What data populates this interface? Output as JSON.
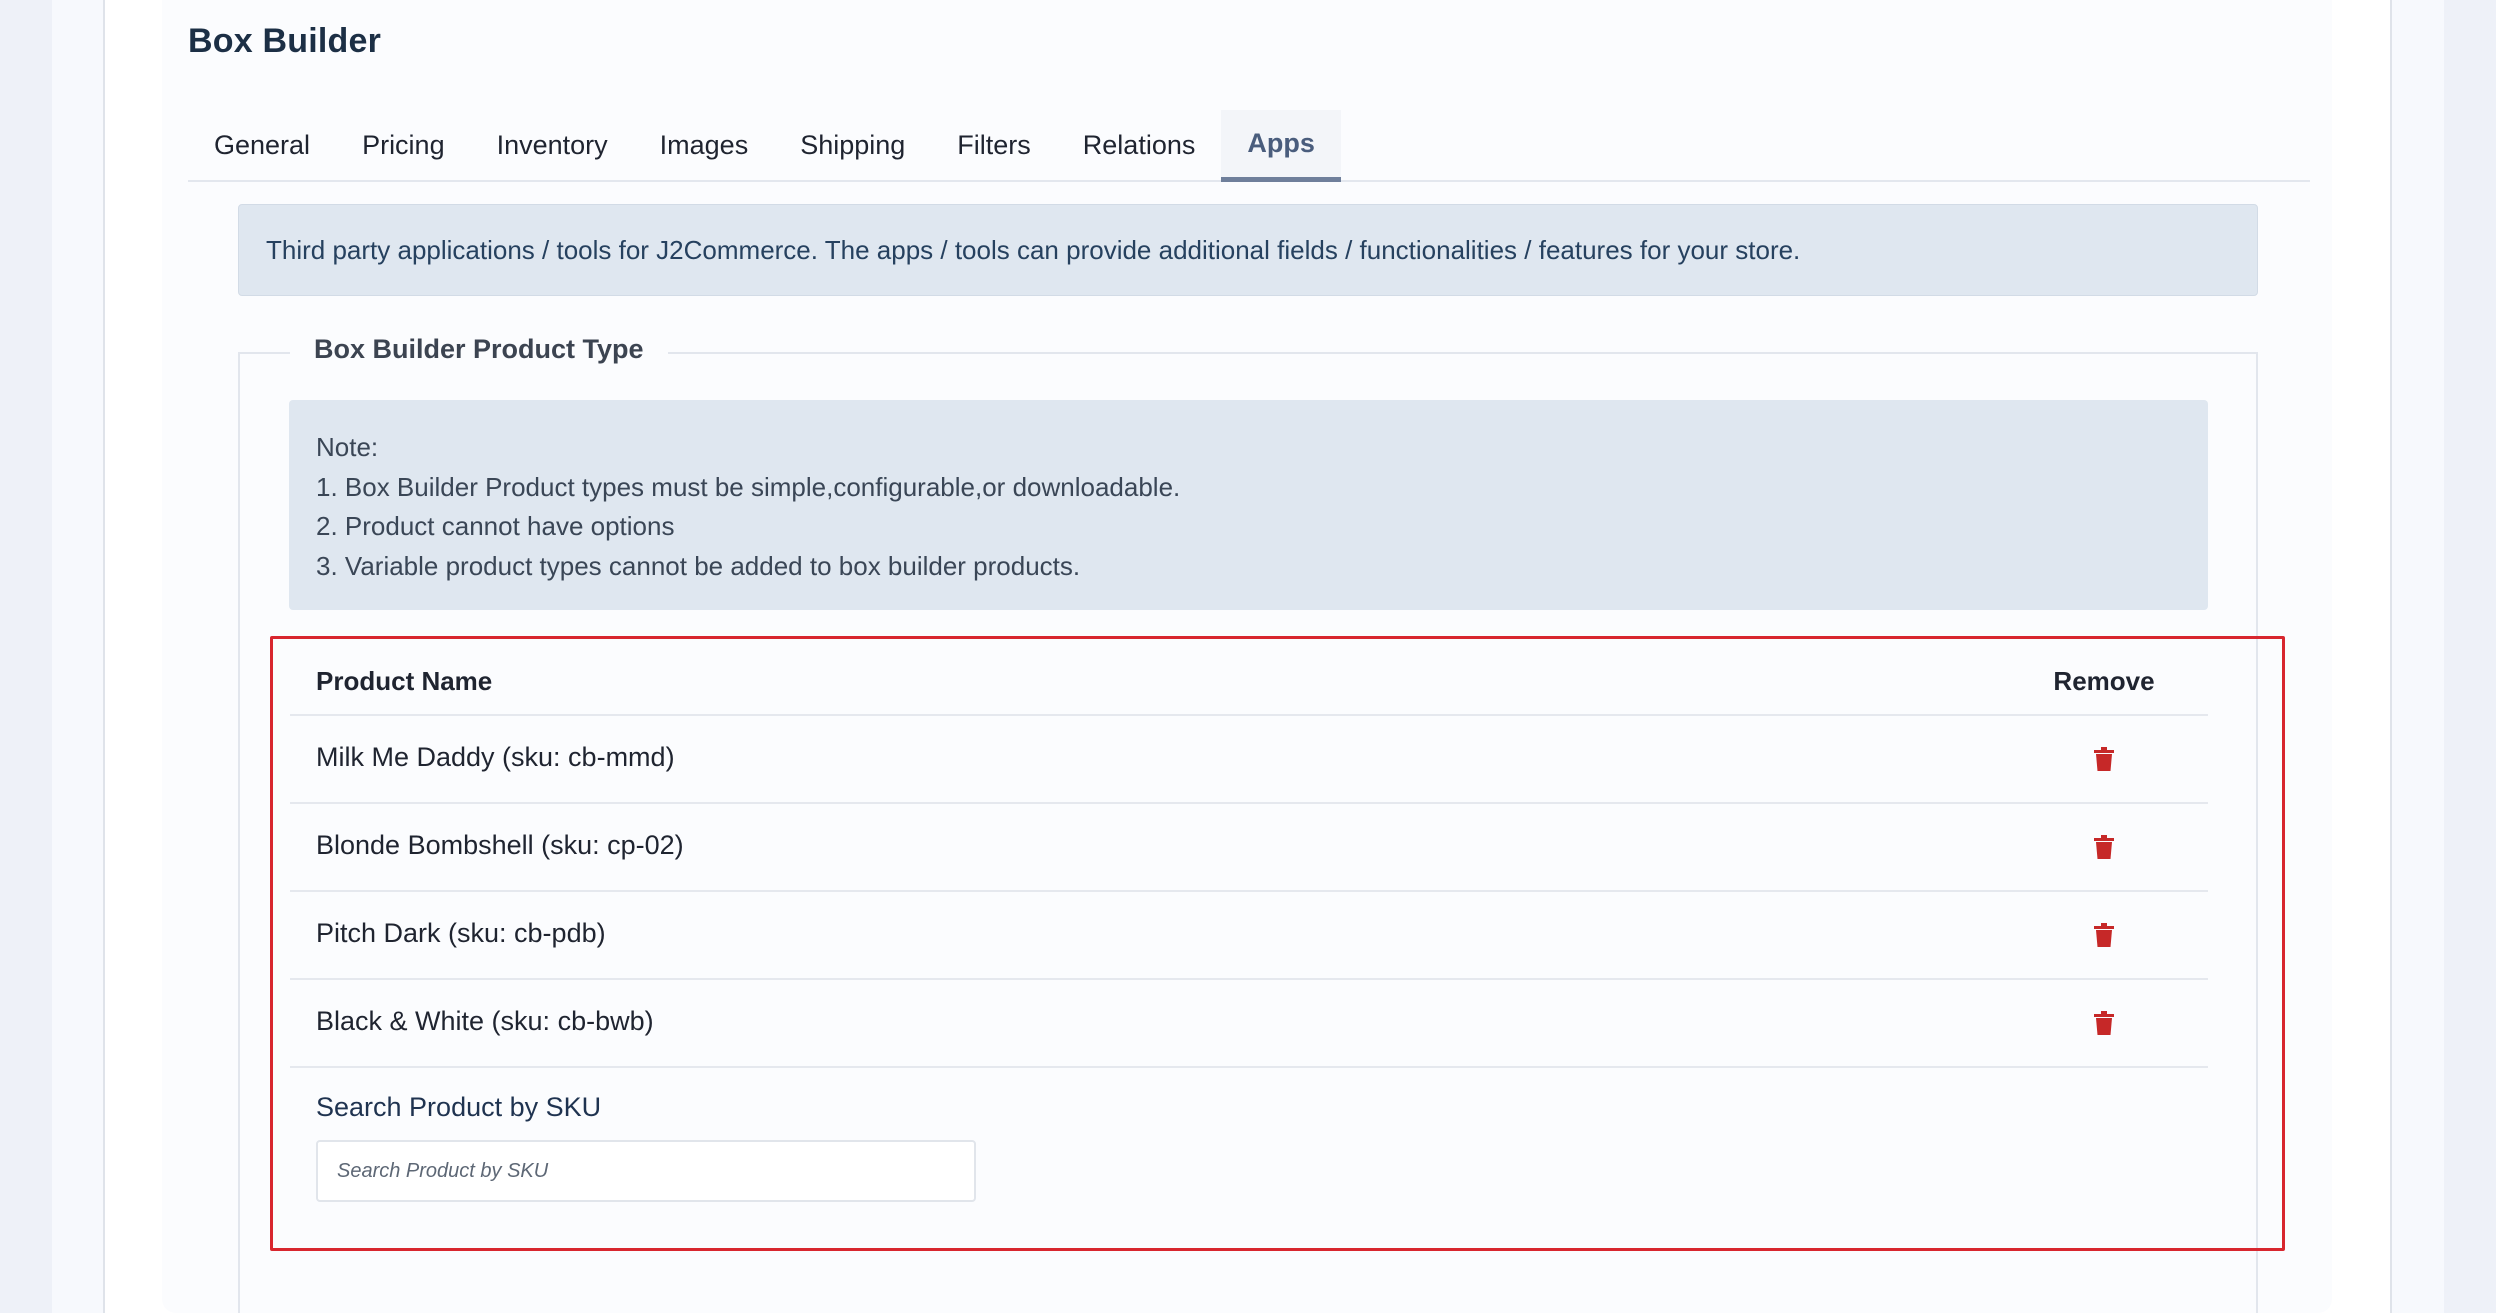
{
  "card": {
    "title": "Box Builder"
  },
  "tabs": [
    {
      "label": "General"
    },
    {
      "label": "Pricing"
    },
    {
      "label": "Inventory"
    },
    {
      "label": "Images"
    },
    {
      "label": "Shipping"
    },
    {
      "label": "Filters"
    },
    {
      "label": "Relations"
    },
    {
      "label": "Apps",
      "active": true
    }
  ],
  "apps_info": "Third party applications / tools for J2Commerce. The apps / tools can provide additional fields / functionalities / features for your store.",
  "fieldset": {
    "legend": "Box Builder Product Type",
    "note": {
      "title": "Note:",
      "lines": [
        "1. Box Builder Product types must be simple,configurable,or downloadable.",
        "2. Product cannot have options",
        "3. Variable product types cannot be added to box builder products."
      ]
    }
  },
  "table": {
    "headers": {
      "name": "Product Name",
      "remove": "Remove"
    },
    "rows": [
      {
        "name": "Milk Me Daddy (sku: cb-mmd)",
        "remove_icon": "trash-icon"
      },
      {
        "name": "Blonde Bombshell (sku: cp-02)",
        "remove_icon": "trash-icon"
      },
      {
        "name": "Pitch Dark (sku: cb-pdb)",
        "remove_icon": "trash-icon"
      },
      {
        "name": "Black & White (sku: cb-bwb)",
        "remove_icon": "trash-icon"
      }
    ]
  },
  "search": {
    "label": "Search Product by SKU",
    "placeholder": "Search Product by SKU",
    "value": ""
  },
  "colors": {
    "highlight_border": "#d8262e",
    "trash_icon": "#c62828",
    "active_tab": "#4a5d7d"
  }
}
